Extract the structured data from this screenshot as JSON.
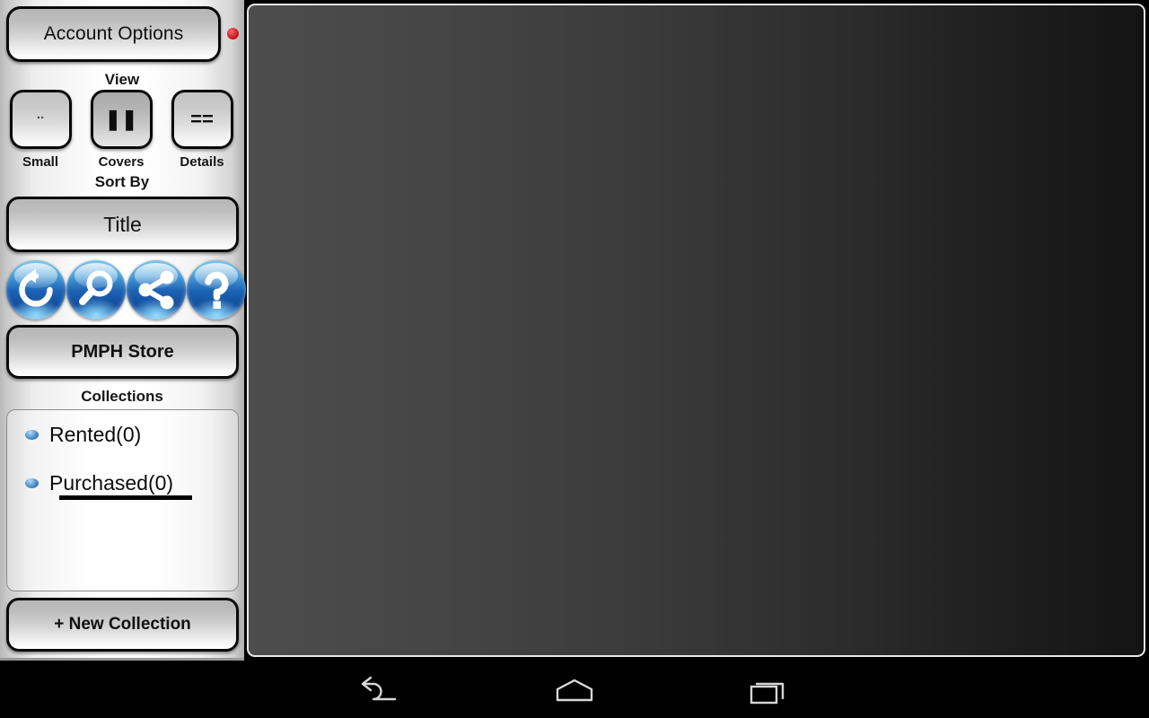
{
  "sidebar": {
    "account_options": {
      "label": "Account Options",
      "status_dot_color": "#d41f1f",
      "status_dot_name": "account-status-indicator"
    },
    "view": {
      "section_label": "View",
      "options": [
        {
          "id": "small",
          "caption": "Small",
          "glyph": "..",
          "selected": false,
          "icon_name": "small-view-icon"
        },
        {
          "id": "covers",
          "caption": "Covers",
          "glyph": "❚❚",
          "selected": true,
          "icon_name": "covers-view-icon"
        },
        {
          "id": "details",
          "caption": "Details",
          "glyph": "==",
          "selected": false,
          "icon_name": "details-view-icon"
        }
      ]
    },
    "sort_by": {
      "section_label": "Sort By",
      "value": "Title"
    },
    "icon_buttons": [
      {
        "id": "refresh",
        "icon_name": "refresh-icon",
        "title": "Refresh"
      },
      {
        "id": "search",
        "icon_name": "search-icon",
        "title": "Search"
      },
      {
        "id": "share",
        "icon_name": "share-icon",
        "title": "Share"
      },
      {
        "id": "help",
        "icon_name": "help-icon",
        "title": "Help"
      }
    ],
    "store_button": {
      "label": "PMPH Store"
    },
    "collections": {
      "section_label": "Collections",
      "items": [
        {
          "label": "Rented(0)",
          "selected": false
        },
        {
          "label": "Purchased(0)",
          "selected": true
        }
      ]
    },
    "new_collection_button": {
      "label": "+ New Collection"
    },
    "accent_color": "#1c62b4"
  },
  "main": {
    "content": "",
    "background_from": "#4d4d4d",
    "background_to": "#141414"
  },
  "nav_bar": {
    "buttons": [
      {
        "id": "back",
        "icon_name": "back-icon"
      },
      {
        "id": "home",
        "icon_name": "home-icon"
      },
      {
        "id": "recent",
        "icon_name": "recent-apps-icon"
      }
    ]
  }
}
